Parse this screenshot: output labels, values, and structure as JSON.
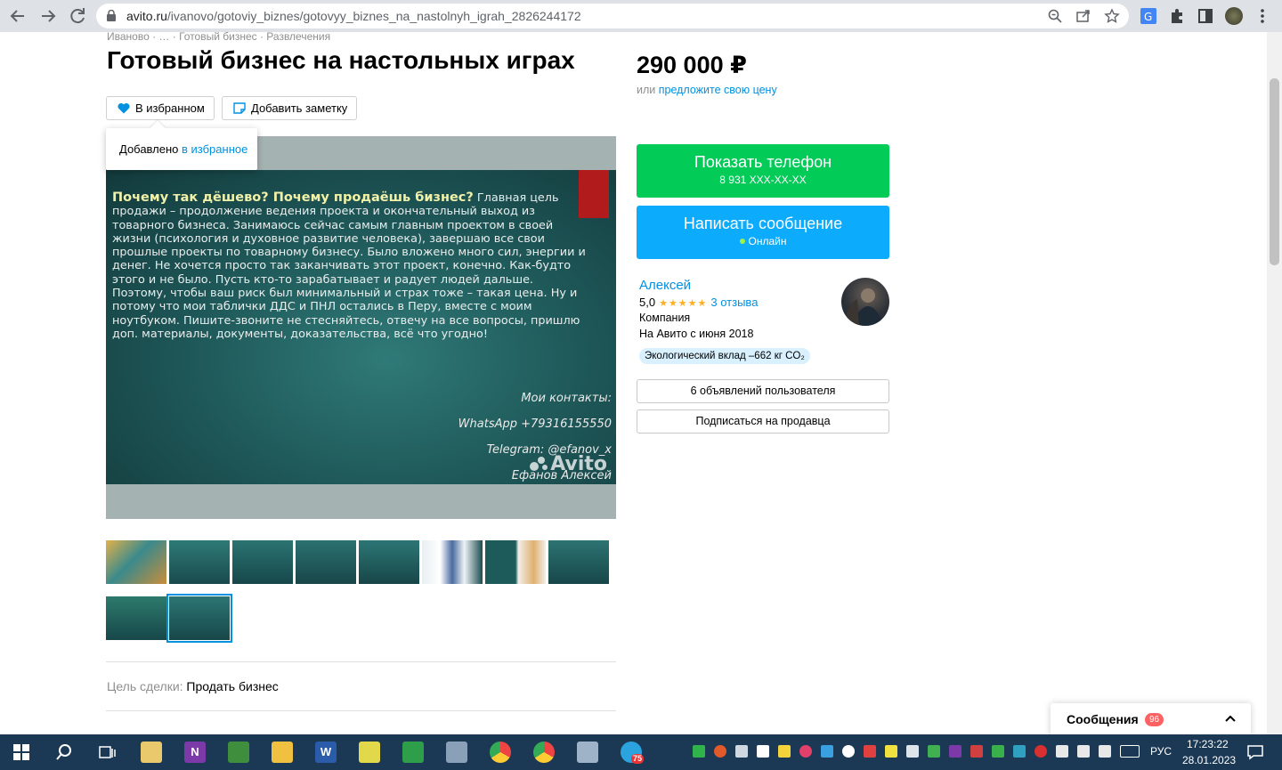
{
  "browser": {
    "url_host": "avito.ru",
    "url_path": "/ivanovo/gotoviy_biznes/gotovyy_biznes_na_nastolnyh_igrah_2826244172"
  },
  "breadcrumb": {
    "text": "Иваново · … · Готовый бизнес · Развлечения"
  },
  "listing": {
    "title": "Готовый бизнес на настольных играх",
    "favorite_label": "В избранном",
    "note_label": "Добавить заметку",
    "tooltip_prefix": "Добавлено ",
    "tooltip_link": "в избранное",
    "price": "290 000 ₽",
    "offer_prefix": "или ",
    "offer_link": "предложите свою цену"
  },
  "slide": {
    "heading": "Почему так дёшево? Почему продаёшь бизнес?",
    "body": " Главная цель продажи – продолжение ведения проекта и окончательный выход из товарного бизнеса. Занимаюсь сейчас самым главным проектом в своей жизни (психология и духовное развитие человека), завершаю все свои прошлые проекты по товарному бизнесу. Было вложено много сил, энергии и денег. Не хочется просто так заканчивать этот проект, конечно. Как-будто этого и не было. Пусть кто-то зарабатывает и радует людей дальше. Поэтому, чтобы ваш риск был минимальный и страх тоже – такая цена. Ну и потому что мои таблички ДДС и ПНЛ остались в Перу, вместе с моим ноутбуком. Пишите-звоните не стесняйтесь, отвечу на все вопросы, пришлю доп. материалы, документы, доказательства, всё что угодно!",
    "contacts_title": "Мои контакты:",
    "whatsapp": "WhatsApp +79316155550",
    "telegram": "Telegram: @efanov_x",
    "name": "Ефанов Алексей",
    "watermark": "Avito"
  },
  "details": {
    "deal_key": "Цель сделки: ",
    "deal_value": "Продать бизнес"
  },
  "actions": {
    "phone_label": "Показать телефон",
    "phone_number": "8 931 XXX-XX-XX",
    "message_label": "Написать сообщение",
    "online": "Онлайн"
  },
  "seller": {
    "name": "Алексей",
    "rating": "5,0",
    "stars": "★★★★★",
    "reviews": "3 отзыва",
    "type": "Компания",
    "since": "На Авито с июня 2018",
    "eco": "Экологический вклад –662 кг CO₂",
    "ads_button": "6 объявлений пользователя",
    "subscribe_button": "Подписаться на продавца"
  },
  "messages": {
    "title": "Сообщения",
    "badge": "96"
  },
  "taskbar": {
    "telegram_badge": "75",
    "lang": "РУС",
    "time": "17:23:22",
    "date": "28.01.2023"
  },
  "colors": {
    "link": "#0091e0",
    "green_button": "#02cb58",
    "blue_button": "#0cabfb",
    "taskbar": "#1b3954"
  }
}
